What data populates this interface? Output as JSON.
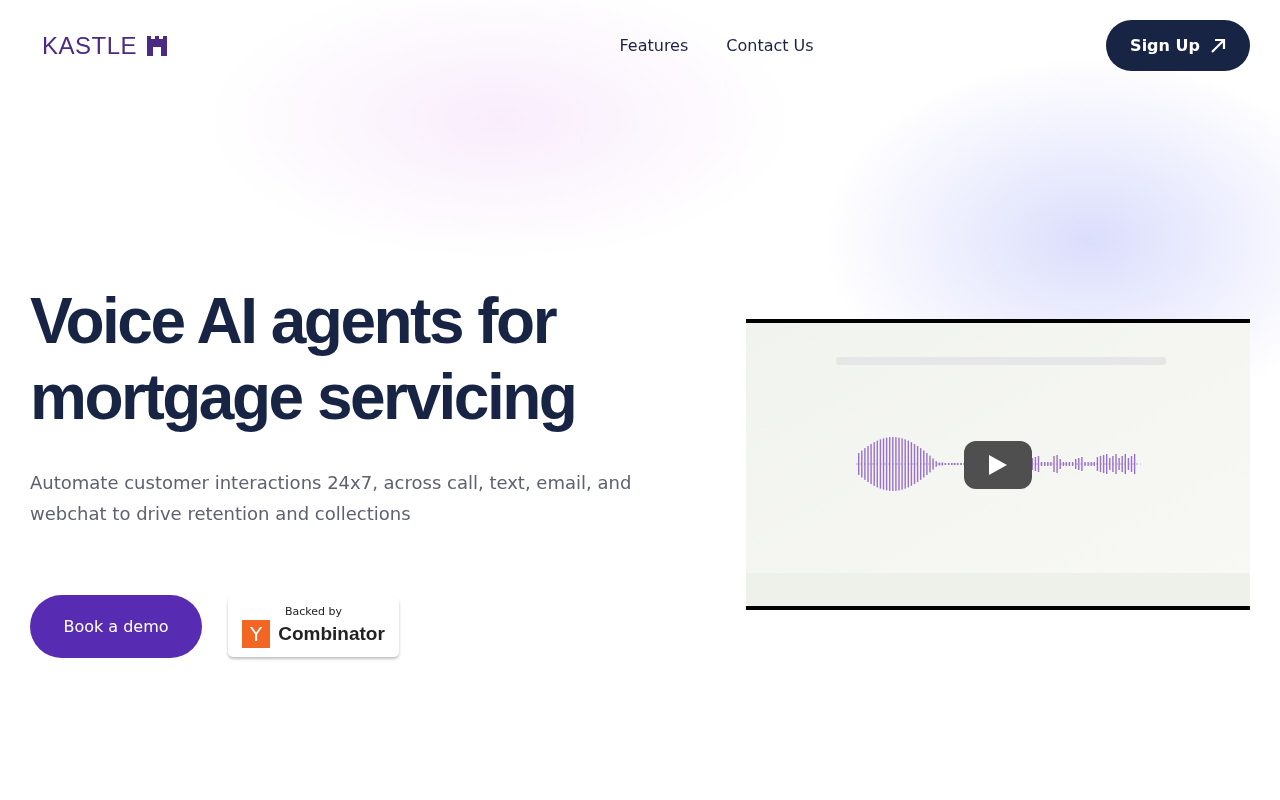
{
  "header": {
    "logo": "KASTLE",
    "nav": [
      {
        "label": "Features"
      },
      {
        "label": "Contact Us"
      }
    ],
    "cta": "Sign Up"
  },
  "hero": {
    "title_lines": [
      "Voice AI agents for",
      "mortgage servicing"
    ],
    "subtitle": "Automate customer interactions 24x7, across call, text, email, and webchat to drive retention and collections",
    "button": "Book a demo",
    "badge": {
      "top": "Backed by",
      "mark": "Y",
      "name": "Combinator"
    }
  }
}
